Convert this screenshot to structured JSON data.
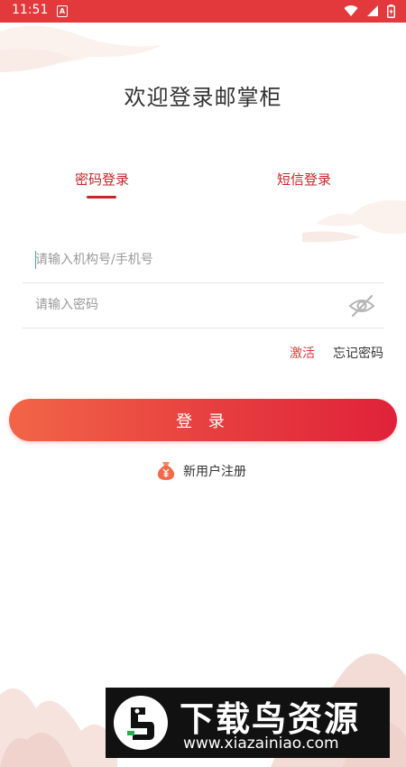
{
  "status_bar": {
    "time": "11:51",
    "notification_icon": "a-icon",
    "icons": [
      "wifi-icon",
      "signal-icon",
      "battery-icon"
    ]
  },
  "title": "欢迎登录邮掌柜",
  "tabs": {
    "password_login": "密码登录",
    "sms_login": "短信登录",
    "active": "password_login"
  },
  "form": {
    "account_placeholder": "请输入机构号/手机号",
    "account_value": "",
    "password_placeholder": "请输入密码",
    "password_value": "",
    "password_toggle_icon": "eye-off-icon"
  },
  "links": {
    "activate": "激活",
    "forgot_password": "忘记密码"
  },
  "login_button": "登 录",
  "register": {
    "icon": "money-bag-icon",
    "label": "新用户注册"
  },
  "watermark": {
    "title": "下载鸟资源",
    "url": "www.xiazainiao.com"
  },
  "colors": {
    "accent": "#e4393c",
    "tab_active": "#c8242a",
    "button_gradient_start": "#f26547",
    "button_gradient_end": "#e0223a"
  }
}
